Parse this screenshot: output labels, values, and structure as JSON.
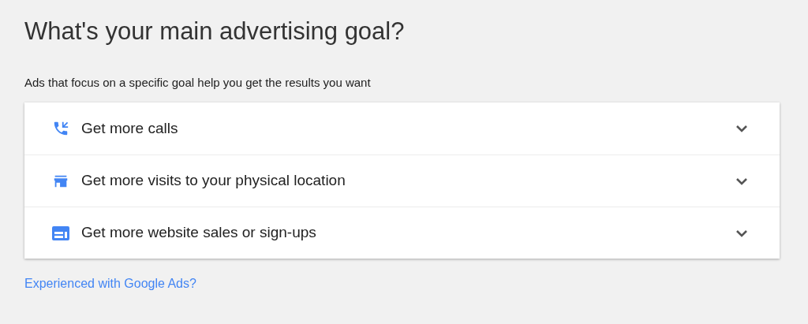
{
  "title": "What's your main advertising goal?",
  "subtitle": "Ads that focus on a specific goal help you get the results you want",
  "goals": [
    {
      "kind": "calls",
      "label": "Get more calls",
      "expanded": false
    },
    {
      "kind": "visits",
      "label": "Get more visits to your physical location",
      "expanded": false
    },
    {
      "kind": "website",
      "label": "Get more website sales or sign-ups",
      "expanded": false
    }
  ],
  "link": "Experienced with Google Ads?"
}
